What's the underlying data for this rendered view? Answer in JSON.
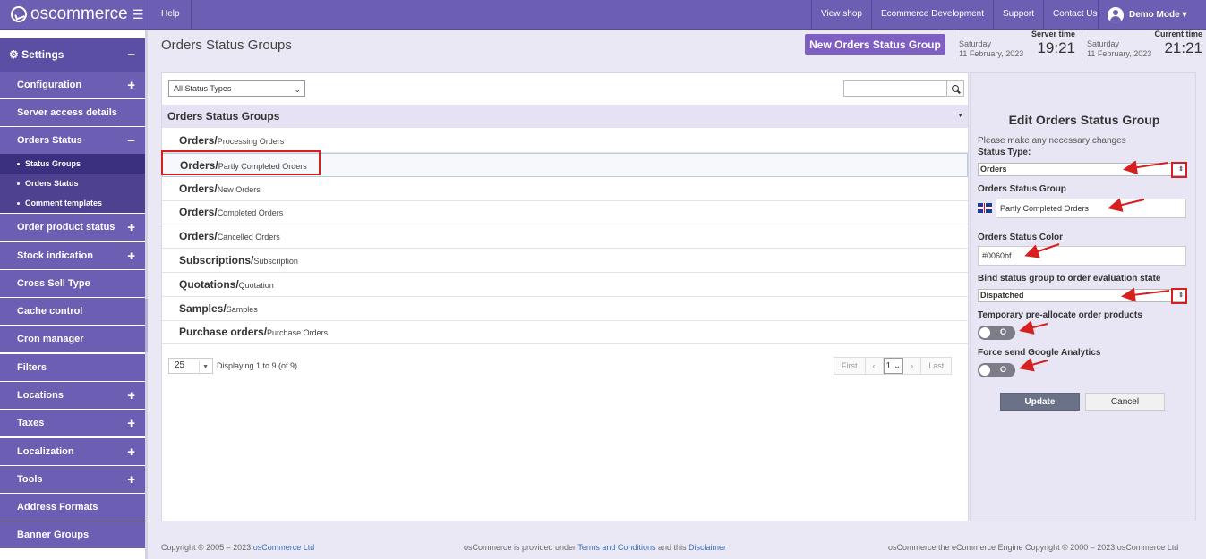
{
  "app": {
    "brand": "oscommerce"
  },
  "topbar": {
    "help": "Help",
    "nav": [
      "View shop",
      "Ecommerce Development",
      "Support",
      "Contact Us"
    ],
    "user": "Demo Mode ▾"
  },
  "sidebar": {
    "settings": "Settings",
    "items": [
      {
        "label": "Configuration",
        "plus": "+"
      },
      {
        "label": "Server access details",
        "plus": ""
      },
      {
        "label": "Orders Status",
        "plus": "−"
      },
      {
        "label": "Order product status",
        "plus": "+"
      },
      {
        "label": "Stock indication",
        "plus": "+"
      },
      {
        "label": "Cross Sell Type",
        "plus": ""
      },
      {
        "label": "Cache control",
        "plus": ""
      },
      {
        "label": "Cron manager",
        "plus": ""
      },
      {
        "label": "Filters",
        "plus": ""
      },
      {
        "label": "Locations",
        "plus": "+"
      },
      {
        "label": "Taxes",
        "plus": "+"
      },
      {
        "label": "Localization",
        "plus": "+"
      },
      {
        "label": "Tools",
        "plus": "+"
      },
      {
        "label": "Address Formats",
        "plus": ""
      },
      {
        "label": "Banner Groups",
        "plus": ""
      }
    ],
    "subitems": [
      "Status Groups",
      "Orders Status",
      "Comment templates"
    ]
  },
  "header": {
    "title": "Orders Status Groups",
    "new_button": "New Orders Status Group",
    "server_time": {
      "label": "Server time",
      "day": "Saturday",
      "date": "11 February, 2023",
      "time": "19:21"
    },
    "current_time": {
      "label": "Current time",
      "day": "Saturday",
      "date": "11 February, 2023",
      "time": "21:21"
    }
  },
  "main": {
    "filter": "All Status Types",
    "list_header": "Orders Status Groups",
    "rows": [
      {
        "group": "Orders/",
        "name": "Processing Orders"
      },
      {
        "group": "Orders/",
        "name": "Partly Completed Orders"
      },
      {
        "group": "Orders/",
        "name": "New Orders"
      },
      {
        "group": "Orders/",
        "name": "Completed Orders"
      },
      {
        "group": "Orders/",
        "name": "Cancelled Orders"
      },
      {
        "group": "Subscriptions/",
        "name": "Subscription"
      },
      {
        "group": "Quotations/",
        "name": "Quotation"
      },
      {
        "group": "Samples/",
        "name": "Samples"
      },
      {
        "group": "Purchase orders/",
        "name": "Purchase Orders"
      }
    ],
    "per_page": "25",
    "displaying": "Displaying 1 to 9 (of 9)",
    "pager": {
      "first": "First",
      "prev": "‹",
      "page": "1",
      "next": "›",
      "last": "Last"
    }
  },
  "edit": {
    "title": "Edit Orders Status Group",
    "hint": "Please make any necessary changes",
    "status_type_label": "Status Type:",
    "status_type_value": "Orders",
    "group_label": "Orders Status Group",
    "group_value": "Partly Completed Orders",
    "color_label": "Orders Status Color",
    "color_value": "#0060bf",
    "bind_label": "Bind status group to order evaluation state",
    "bind_value": "Dispatched",
    "preallocate_label": "Temporary pre-allocate order products",
    "preallocate_toggle": "O",
    "analytics_label": "Force send Google Analytics",
    "analytics_toggle": "O",
    "update": "Update",
    "cancel": "Cancel"
  },
  "footer": {
    "left_text": "Copyright © 2005 – 2023 ",
    "left_link": "osCommerce Ltd",
    "mid_1": "osCommerce is provided under ",
    "mid_link1": "Terms and Conditions",
    "mid_2": " and this ",
    "mid_link2": "Disclaimer",
    "right": "osCommerce the eCommerce Engine Copyright © 2000 – 2023 osCommerce Ltd"
  },
  "colors": {
    "accent": "#6c5fb3",
    "button": "#7f5fc2",
    "annotation": "#d62020"
  }
}
